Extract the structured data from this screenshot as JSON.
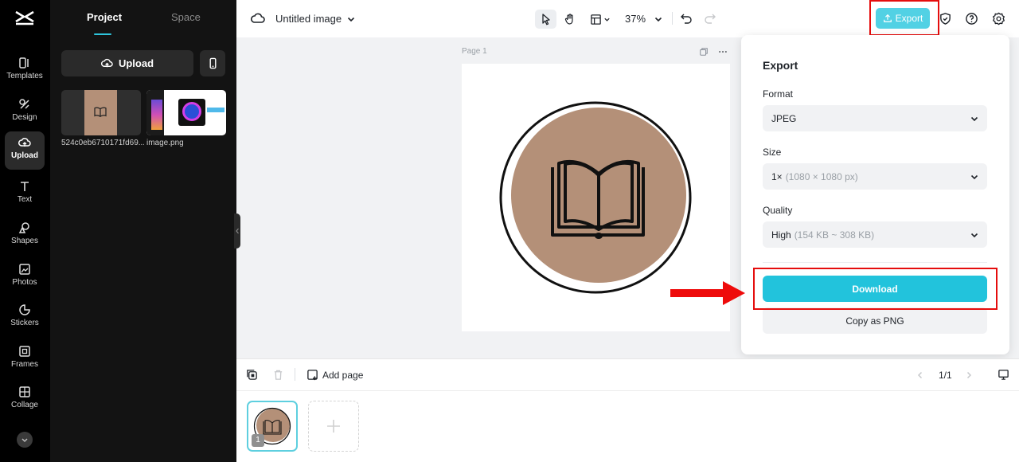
{
  "colors": {
    "accent": "#22c3dc",
    "export_button": "#52d1e4",
    "highlight": "#e50d0d",
    "circle_fill": "#b49078"
  },
  "rail": {
    "items": [
      {
        "label": "Templates",
        "icon": "templates-icon"
      },
      {
        "label": "Design",
        "icon": "design-icon"
      },
      {
        "label": "Upload",
        "icon": "upload-cloud-icon"
      },
      {
        "label": "Text",
        "icon": "text-icon"
      },
      {
        "label": "Shapes",
        "icon": "shapes-icon"
      },
      {
        "label": "Photos",
        "icon": "photos-icon"
      },
      {
        "label": "Stickers",
        "icon": "stickers-icon"
      },
      {
        "label": "Frames",
        "icon": "frames-icon"
      },
      {
        "label": "Collage",
        "icon": "collage-icon"
      }
    ]
  },
  "panel": {
    "tabs": [
      "Project",
      "Space"
    ],
    "upload_label": "Upload",
    "files": [
      {
        "name": "524c0eb6710171fd69..."
      },
      {
        "name": "image.png"
      }
    ]
  },
  "topbar": {
    "title": "Untitled image",
    "zoom": "37%",
    "export_label": "Export"
  },
  "canvas": {
    "page_label": "Page 1"
  },
  "export_panel": {
    "title": "Export",
    "format_label": "Format",
    "format_value": "JPEG",
    "size_label": "Size",
    "size_value": "1×",
    "size_detail": "(1080 × 1080 px)",
    "quality_label": "Quality",
    "quality_value": "High",
    "quality_detail": "(154 KB ~ 308 KB)",
    "download_label": "Download",
    "copy_label": "Copy as PNG"
  },
  "bottombar": {
    "add_page_label": "Add page",
    "pager": "1/1",
    "page_number": "1"
  }
}
